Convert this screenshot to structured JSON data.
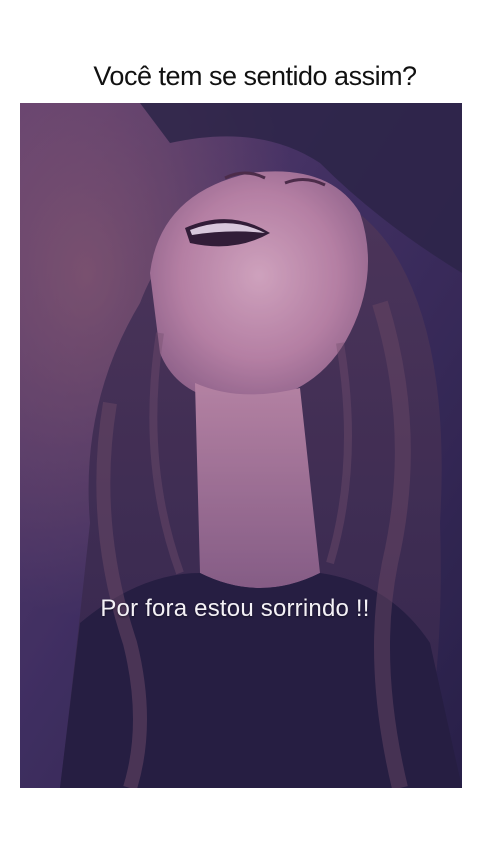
{
  "post": {
    "headline": "Você tem se sentido assim?"
  },
  "video": {
    "caption": "Por fora estou sorrindo !!",
    "colors": {
      "background": "#2b2447",
      "tint": "#6a4a86",
      "skin": "#d9a6b8",
      "hair": "#5a3b4e"
    }
  }
}
